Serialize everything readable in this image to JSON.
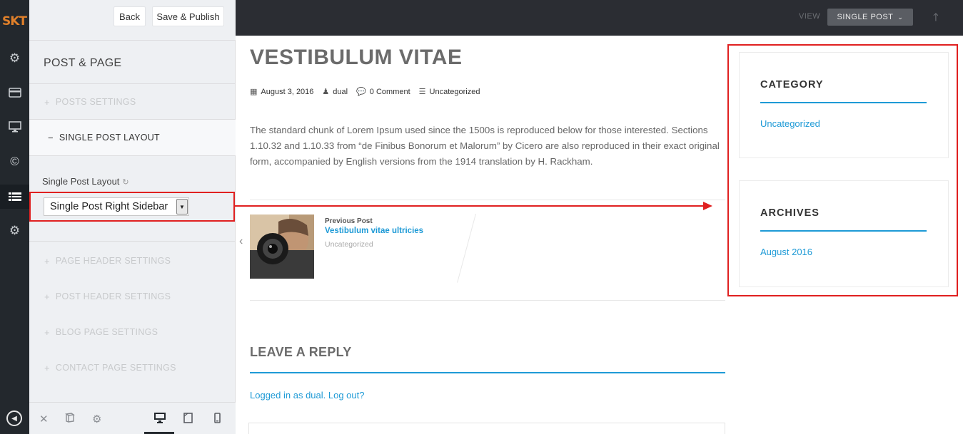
{
  "rail": {
    "logo": "SKT",
    "icons": [
      "gear-icon",
      "card-icon",
      "monitor-icon",
      "copyright-icon",
      "layout-icon",
      "gear-icon",
      "back-circle-icon"
    ]
  },
  "panel": {
    "back_label": "Back",
    "publish_label": "Save & Publish",
    "section_title": "POST & PAGE",
    "accordion": [
      {
        "label": "POSTS SETTINGS",
        "sign": "+"
      },
      {
        "label": "SINGLE POST LAYOUT",
        "sign": "−"
      },
      {
        "label": "PAGE HEADER SETTINGS",
        "sign": "+"
      },
      {
        "label": "POST HEADER SETTINGS",
        "sign": "+"
      },
      {
        "label": "BLOG PAGE SETTINGS",
        "sign": "+"
      },
      {
        "label": "CONTACT PAGE SETTINGS",
        "sign": "+"
      }
    ],
    "control_label": "Single Post Layout",
    "select_value": "Single Post Right Sidebar"
  },
  "preview_bar": {
    "view_label": "VIEW",
    "view_select": "SINGLE POST"
  },
  "post": {
    "title": "VESTIBULUM VITAE",
    "date": "August 3, 2016",
    "author": "dual",
    "comments": "0 Comment",
    "category": "Uncategorized",
    "excerpt": "The standard chunk of Lorem Ipsum used since the 1500s is reproduced below for those interested. Sections 1.10.32 and 1.10.33 from “de Finibus Bonorum et Malorum” by Cicero are also reproduced in their exact original form, accompanied by English versions from the 1914 translation by H. Rackham."
  },
  "prev_post": {
    "label": "Previous Post",
    "title": "Vestibulum vitae ultricies",
    "category": "Uncategorized"
  },
  "reply": {
    "title": "LEAVE A REPLY",
    "logged_in": "Logged in as dual. Log out?"
  },
  "sidebar": {
    "widgets": [
      {
        "title": "CATEGORY",
        "link": "Uncategorized"
      },
      {
        "title": "ARCHIVES",
        "link": "August 2016"
      }
    ]
  },
  "colors": {
    "accent": "#1e9ad6",
    "highlight": "#e02020",
    "rail": "#23282d"
  }
}
